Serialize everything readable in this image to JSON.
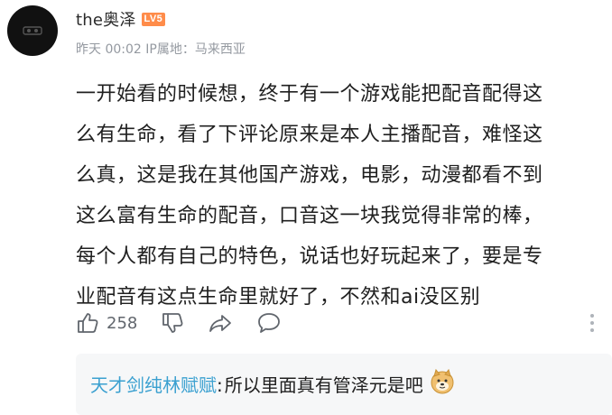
{
  "comment": {
    "author": "the奥泽",
    "level_badge": "LV5",
    "meta": "昨天 00:02 IP属地：马来西亚",
    "text": "一开始看的时候想，终于有一个游戏能把配音配得这\n么有生命，看了下评论原来是本人主播配音，难怪这\n么真，这是我在其他国产游戏，电影，动漫都看不到\n这么富有生命的配音，口音这一块我觉得非常的棒，\n每个人都有自己的特色，说话也好玩起来了，要是专\n业配音有这点生命里就好了，不然和ai没区别",
    "like_count": "258"
  },
  "actions": {
    "like_icon": "thumbs-up-icon",
    "dislike_icon": "thumbs-down-icon",
    "share_icon": "share-icon",
    "reply_icon": "comment-icon",
    "more_icon": "vertical-dots-icon"
  },
  "reply": {
    "user": "天才剑纯林赋赋",
    "separator": ":",
    "text": " 所以里面真有管泽元是吧",
    "emoji": "doge-emoji"
  },
  "colors": {
    "level_badge": "#ff8c4a",
    "reply_user": "#3aa0d0",
    "meta": "#9499a0",
    "reply_bg": "#f6f7f8"
  }
}
